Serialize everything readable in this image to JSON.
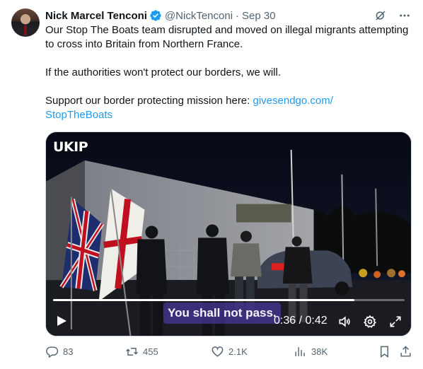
{
  "author": {
    "name": "Nick Marcel Tenconi",
    "handle": "@NickTenconi",
    "separator": "·",
    "date": "Sep 30",
    "verified": true
  },
  "tweet": {
    "para1": "Our Stop The Boats team disrupted and moved on illegal migrants attempting to cross into Britain from Northern France.",
    "para2": "If the authorities won't protect our borders, we will.",
    "para3_text": "Support our border protecting mission here: ",
    "link_line1": "givesendgo.com/",
    "link_line2": "StopTheBoats"
  },
  "video": {
    "watermark": "UKIP",
    "caption": "You shall not pass.",
    "time_current": "0:36",
    "time_separator": " / ",
    "time_total": "0:42",
    "progress_fraction": 0.857
  },
  "actions": {
    "replies": "83",
    "reposts": "455",
    "likes": "2.1K",
    "views": "38K"
  },
  "colors": {
    "accent": "#1d9bf0",
    "muted": "#536471",
    "text": "#0f1419"
  },
  "icons": [
    "grok-icon",
    "more-icon",
    "verified-badge-icon",
    "play-icon",
    "volume-icon",
    "settings-icon",
    "fullscreen-icon",
    "reply-icon",
    "repost-icon",
    "like-icon",
    "views-icon",
    "bookmark-icon",
    "share-icon"
  ]
}
